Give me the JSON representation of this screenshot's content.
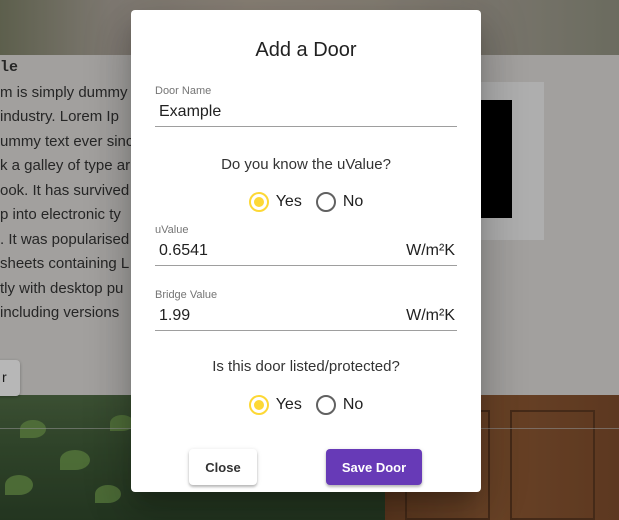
{
  "background": {
    "heading": "le",
    "paragraph_lines": [
      "m is simply dummy",
      " industry. Lorem Ip",
      "ummy text ever sinc",
      "k a galley of type ar",
      "ook. It has survived",
      "p into electronic ty",
      ". It was popularised",
      "sheets containing L",
      "tly with desktop pu",
      " including versions"
    ],
    "button_label": "r"
  },
  "dialog": {
    "title": "Add a Door",
    "door_name": {
      "label": "Door Name",
      "value": "Example"
    },
    "uvalue_question": "Do you know the uValue?",
    "uvalue_options": {
      "yes": "Yes",
      "no": "No",
      "selected": "Yes"
    },
    "uvalue": {
      "label": "uValue",
      "value": "0.6541",
      "unit": "W/m²K"
    },
    "bridge_value": {
      "label": "Bridge Value",
      "value": "1.99",
      "unit": "W/m²K"
    },
    "listed_question": "Is this door listed/protected?",
    "listed_options": {
      "yes": "Yes",
      "no": "No",
      "selected": "Yes"
    },
    "close_label": "Close",
    "save_label": "Save Door"
  },
  "colors": {
    "accent_radio": "#fdd835",
    "primary_button": "#673ab7"
  }
}
